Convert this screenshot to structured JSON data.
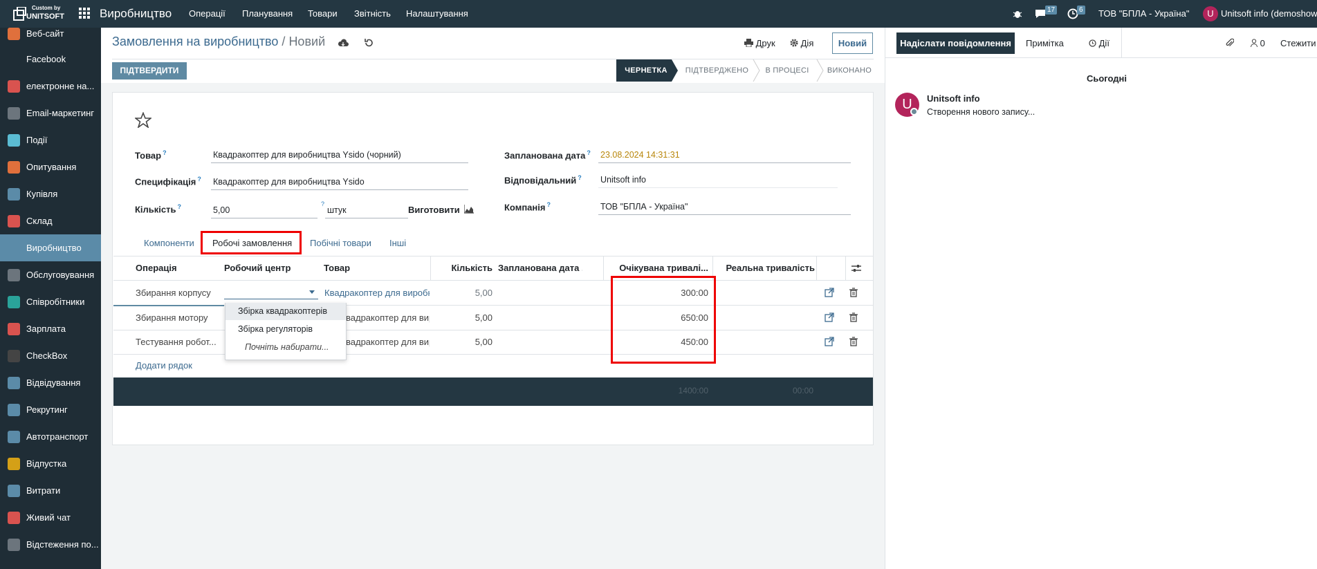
{
  "topbar": {
    "brand_top": "Custom by",
    "brand_bottom": "UNITSOFT",
    "app_name": "Виробництво",
    "menu": [
      "Операції",
      "Планування",
      "Товари",
      "Звітність",
      "Налаштування"
    ],
    "messages_count": "17",
    "activities_count": "6",
    "company": "ТОВ \"БПЛА - Україна\"",
    "user_initial": "U",
    "user": "Unitsoft info (demoshow"
  },
  "sidebar": {
    "items": [
      {
        "label": "Веб-сайт",
        "icon": "globe-icon",
        "color": "#e0703c"
      },
      {
        "label": "Facebook",
        "icon": "facebook-icon",
        "color": "#1f2d36"
      },
      {
        "label": "електронне на...",
        "icon": "elearning-icon",
        "color": "#d9534f"
      },
      {
        "label": "Email-маркетинг",
        "icon": "email-icon",
        "color": "#6c757d"
      },
      {
        "label": "Події",
        "icon": "events-icon",
        "color": "#5bbcd3"
      },
      {
        "label": "Опитування",
        "icon": "survey-icon",
        "color": "#e0703c"
      },
      {
        "label": "Купівля",
        "icon": "purchase-icon",
        "color": "#5b8ba8"
      },
      {
        "label": "Склад",
        "icon": "inventory-icon",
        "color": "#d9534f"
      },
      {
        "label": "Виробництво",
        "icon": "manufacturing-icon",
        "color": "#5b8ba8"
      },
      {
        "label": "Обслуговування",
        "icon": "maintenance-icon",
        "color": "#6c757d"
      },
      {
        "label": "Співробітники",
        "icon": "employees-icon",
        "color": "#2aa39a"
      },
      {
        "label": "Зарплата",
        "icon": "payroll-icon",
        "color": "#d9534f"
      },
      {
        "label": "CheckBox",
        "icon": "checkbox-icon",
        "color": "#444"
      },
      {
        "label": "Відвідування",
        "icon": "attendance-icon",
        "color": "#5b8ba8"
      },
      {
        "label": "Рекрутинг",
        "icon": "recruitment-icon",
        "color": "#5b8ba8"
      },
      {
        "label": "Автотранспорт",
        "icon": "fleet-icon",
        "color": "#5b8ba8"
      },
      {
        "label": "Відпустка",
        "icon": "timeoff-icon",
        "color": "#d4a017"
      },
      {
        "label": "Витрати",
        "icon": "expenses-icon",
        "color": "#5b8ba8"
      },
      {
        "label": "Живий чат",
        "icon": "livechat-icon",
        "color": "#d9534f"
      },
      {
        "label": "Відстеження по...",
        "icon": "tracking-icon",
        "color": "#6c757d"
      }
    ],
    "active_index": 8
  },
  "breadcrumb": {
    "parent": "Замовлення на виробництво",
    "separator": "/",
    "current": "Новий"
  },
  "actions": {
    "print": "Друк",
    "action": "Дія",
    "new": "Новий"
  },
  "statusbar": {
    "confirm": "ПІДТВЕРДИТИ",
    "stages": [
      "ЧЕРНЕТКА",
      "ПІДТВЕРДЖЕНО",
      "В ПРОЦЕСІ",
      "ВИКОНАНО"
    ],
    "active_stage": 0
  },
  "form": {
    "product_label": "Товар",
    "product_value": "Квадракоптер для виробництва Ysido (чорний)",
    "bom_label": "Специфікація",
    "bom_value": "Квадракоптер для виробництва Ysido",
    "qty_label": "Кількість",
    "qty_value": "5,00",
    "uom_value": "штук",
    "produce_label": "Виготовити",
    "date_label": "Запланована дата",
    "date_value": "23.08.2024 14:31:31",
    "responsible_label": "Відповідальний",
    "responsible_value": "Unitsoft info",
    "company_label": "Компанія",
    "company_value": "ТОВ \"БПЛА - Україна\"",
    "help_mark": "?"
  },
  "tabs": [
    "Компоненти",
    "Робочі замовлення",
    "Побічні товари",
    "Інші"
  ],
  "table": {
    "headers": [
      "Операція",
      "Робочий центр",
      "Товар",
      "Кількість",
      "Запланована дата ...",
      "Очікувана тривалі...",
      "Реальна тривалість"
    ],
    "rows": [
      {
        "operation": "Збирання корпусу",
        "workcenter": "",
        "product": "Квадракоптер для виробн",
        "qty": "5,00",
        "date": "",
        "expected": "300:00",
        "real": ""
      },
      {
        "operation": "Збирання мотору",
        "workcenter": "",
        "product": "вадракоптер для вир...",
        "qty": "5,00",
        "date": "",
        "expected": "650:00",
        "real": ""
      },
      {
        "operation": "Тестування робот...",
        "workcenter": "",
        "product": "вадракоптер для вир...",
        "qty": "5,00",
        "date": "",
        "expected": "450:00",
        "real": ""
      }
    ],
    "add_line": "Додати рядок",
    "total_expected": "1400:00",
    "total_real": "00:00"
  },
  "dropdown": {
    "options": [
      "Збірка квадракоптерів",
      "Збірка регуляторів"
    ],
    "search_more": "Почніть набирати..."
  },
  "chatter": {
    "send_message": "Надіслати повідомлення",
    "log_note": "Примітка",
    "activities": "Дії",
    "followers_count": "0",
    "follow": "Стежити",
    "date_separator": "Сьогодні",
    "message_author": "Unitsoft info",
    "message_body": "Створення нового запису..."
  }
}
